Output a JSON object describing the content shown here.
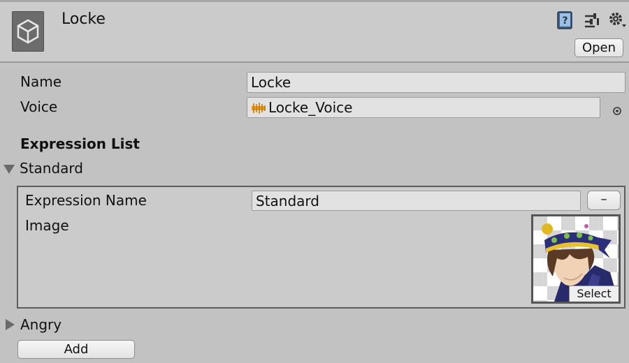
{
  "header": {
    "title": "Locke",
    "open_label": "Open",
    "icons": [
      "unity-logo-icon",
      "help-book-icon",
      "preset-sliders-icon",
      "gear-icon"
    ]
  },
  "fields": {
    "name_label": "Name",
    "name_value": "Locke",
    "voice_label": "Voice",
    "voice_value": "Locke_Voice",
    "voice_icon": "audio-clip-icon",
    "voice_picker_icon": "object-picker-icon"
  },
  "expression_list": {
    "heading": "Expression List",
    "items": [
      {
        "label": "Standard",
        "expanded": true,
        "expression_name_label": "Expression Name",
        "expression_name_value": "Standard",
        "remove_label": "–",
        "image_label": "Image",
        "image_select_label": "Select",
        "image_content": "character-portrait-locke"
      },
      {
        "label": "Angry",
        "expanded": false
      }
    ],
    "add_label": "Add"
  },
  "colors": {
    "background": "#c2c2c2",
    "header_bg": "#cbcbcb",
    "field_bg": "#e2e2e2",
    "audio_icon": "#e59a1f"
  }
}
